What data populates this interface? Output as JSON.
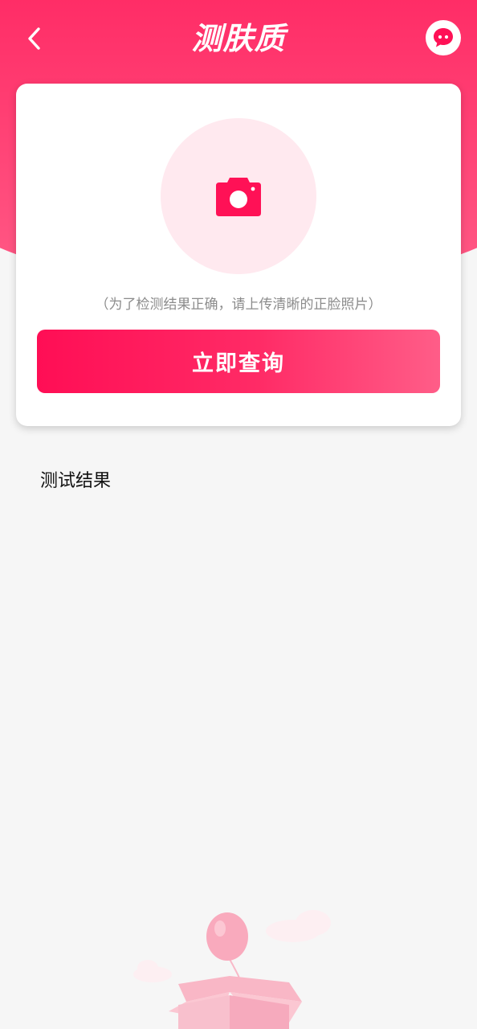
{
  "header": {
    "title": "测肤质",
    "back_icon": "chevron-left-icon",
    "chat_icon": "chat-bubble-icon"
  },
  "upload": {
    "icon": "camera-icon",
    "hint": "（为了检测结果正确，请上传清晰的正脸照片）"
  },
  "actions": {
    "query_label": "立即查询"
  },
  "results": {
    "label": "测试结果"
  },
  "colors": {
    "accent": "#ff1156",
    "accent_light": "#ffe9ef",
    "background": "#f6f6f6"
  }
}
